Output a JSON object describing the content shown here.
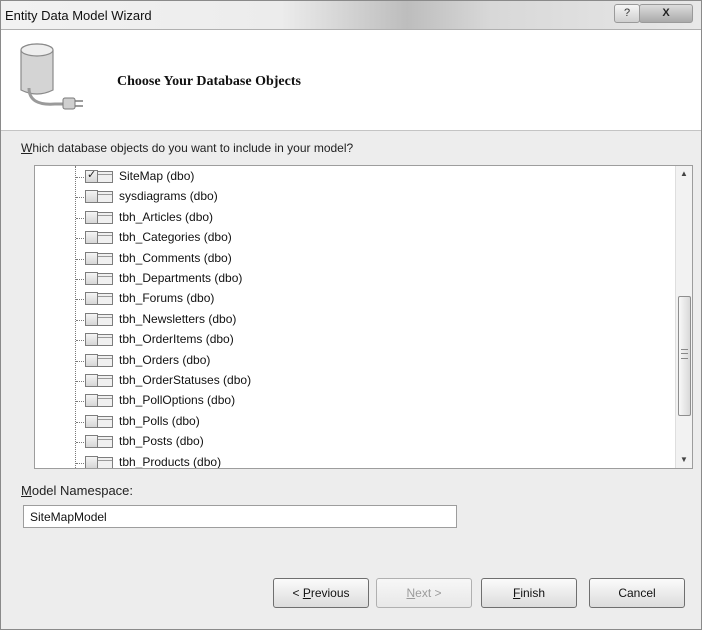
{
  "window": {
    "title": "Entity Data Model Wizard",
    "help_label": "?",
    "close_label": "X"
  },
  "header": {
    "title": "Choose Your Database Objects",
    "icon": "database-icon"
  },
  "prompt": {
    "accel": "W",
    "rest": "hich database objects do you want to include in your model?"
  },
  "objects": [
    {
      "label": "SiteMap (dbo)",
      "checked": true
    },
    {
      "label": "sysdiagrams (dbo)",
      "checked": false
    },
    {
      "label": "tbh_Articles (dbo)",
      "checked": false
    },
    {
      "label": "tbh_Categories (dbo)",
      "checked": false
    },
    {
      "label": "tbh_Comments (dbo)",
      "checked": false
    },
    {
      "label": "tbh_Departments (dbo)",
      "checked": false
    },
    {
      "label": "tbh_Forums (dbo)",
      "checked": false
    },
    {
      "label": "tbh_Newsletters (dbo)",
      "checked": false
    },
    {
      "label": "tbh_OrderItems (dbo)",
      "checked": false
    },
    {
      "label": "tbh_Orders (dbo)",
      "checked": false
    },
    {
      "label": "tbh_OrderStatuses (dbo)",
      "checked": false
    },
    {
      "label": "tbh_PollOptions (dbo)",
      "checked": false
    },
    {
      "label": "tbh_Polls (dbo)",
      "checked": false
    },
    {
      "label": "tbh_Posts (dbo)",
      "checked": false
    },
    {
      "label": "tbh_Products (dbo)",
      "checked": false
    }
  ],
  "namespace": {
    "accel": "M",
    "rest": "odel Namespace:",
    "value": "SiteMapModel"
  },
  "buttons": {
    "previous": {
      "before": "< ",
      "accel": "P",
      "rest": "revious"
    },
    "next": {
      "accel": "N",
      "rest": "ext >"
    },
    "finish": {
      "accel": "F",
      "rest": "inish"
    },
    "cancel": {
      "label": "Cancel"
    }
  }
}
